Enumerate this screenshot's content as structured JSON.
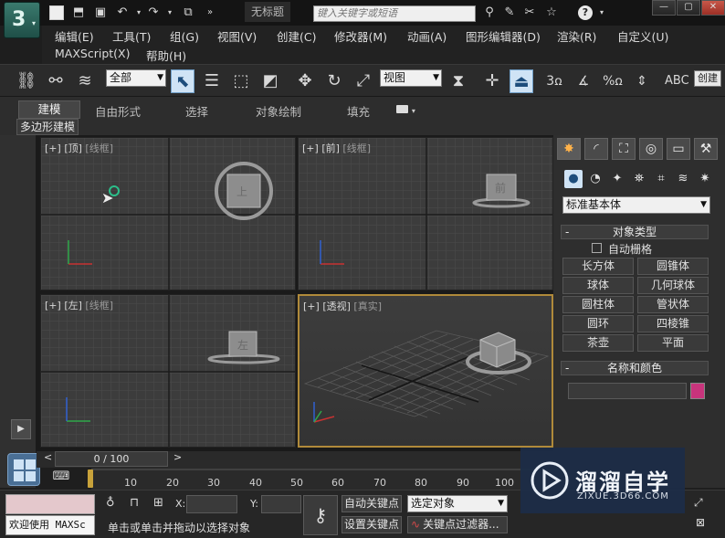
{
  "app": {
    "title": "无标题",
    "search_placeholder": "键入关键字或短语",
    "window_buttons": [
      "—",
      "▢",
      "✕"
    ]
  },
  "menus": [
    "编辑(E)",
    "工具(T)",
    "组(G)",
    "视图(V)",
    "创建(C)",
    "修改器(M)",
    "动画(A)",
    "图形编辑器(D)",
    "渲染(R)",
    "自定义(U)",
    "MAXScript(X)",
    "帮助(H)"
  ],
  "toolbar": {
    "selection_filter": "全部",
    "ref_coord": "视图",
    "create_label": "创建"
  },
  "ribbon": {
    "tabs": [
      "建模",
      "自由形式",
      "选择",
      "对象绘制",
      "填充"
    ],
    "subtab": "多边形建模"
  },
  "viewports": [
    {
      "plus": "[+]",
      "name": "[顶]",
      "shade": "[线框]"
    },
    {
      "plus": "[+]",
      "name": "[前]",
      "shade": "[线框]"
    },
    {
      "plus": "[+]",
      "name": "[左]",
      "shade": "[线框]"
    },
    {
      "plus": "[+]",
      "name": "[透视]",
      "shade": "[真实]"
    }
  ],
  "cube_labels": {
    "top": "上",
    "front": "前",
    "left": "左"
  },
  "cmdpanel": {
    "dropdown": "标准基本体",
    "object_type_title": "对象类型",
    "autogrid_label": "自动栅格",
    "object_buttons": [
      "长方体",
      "圆锥体",
      "球体",
      "几何球体",
      "圆柱体",
      "管状体",
      "圆环",
      "四棱锥",
      "茶壶",
      "平面"
    ],
    "name_color_title": "名称和颜色",
    "object_color": "#c8347c"
  },
  "timeline": {
    "frame_label": "0 / 100",
    "ticks": [
      "10",
      "20",
      "30",
      "40",
      "50",
      "60",
      "70",
      "80",
      "90",
      "100"
    ]
  },
  "status": {
    "welcome": "欢迎使用 MAXSc",
    "prompt": "单击或单击并拖动以选择对象",
    "x_label": "X:",
    "y_label": "Y:",
    "auto_key": "自动关键点",
    "set_key": "设置关键点",
    "key_filter_value": "选定对象",
    "key_filters": "关键点过滤器..."
  },
  "watermark": {
    "brand": "溜溜自学",
    "url": "ZIXUE.3D66.COM"
  },
  "colors": {
    "accent_blue": "#cfe3f5",
    "active_border": "#b08a3a",
    "object_color": "#c8347c"
  }
}
